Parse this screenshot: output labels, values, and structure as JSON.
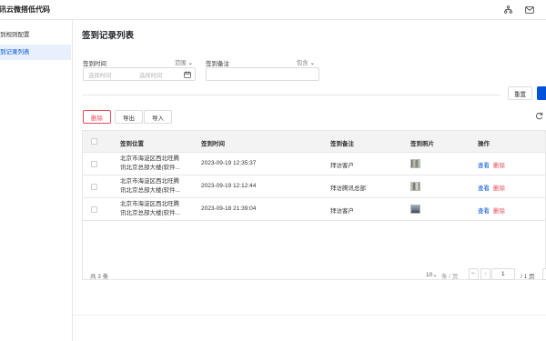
{
  "app": {
    "title": "讯云微搭低代码"
  },
  "header": {
    "icons": [
      "sitemap-icon",
      "mail-icon"
    ]
  },
  "sidebar": {
    "items": [
      {
        "label": "到规则配置",
        "active": false
      },
      {
        "label": "到记录列表",
        "active": true
      }
    ]
  },
  "page": {
    "title": "签到记录列表"
  },
  "filters": {
    "time": {
      "label": "签到时间",
      "mode": "范围",
      "start_placeholder": "选择时间",
      "end_placeholder": "选择时间"
    },
    "note": {
      "label": "签到备注",
      "mode": "包含",
      "value": ""
    }
  },
  "actions": {
    "reset": "重置",
    "delete": "删除",
    "export": "导出",
    "import": "导入"
  },
  "table": {
    "columns": [
      "签到位置",
      "签到时间",
      "签到备注",
      "签到照片",
      "操作"
    ],
    "rows": [
      {
        "location_line1": "北京市海淀区西北旺腾",
        "location_line2": "讯北京总部大楼(软件...",
        "time": "2023-09-19 12:35:37",
        "note": "拜访客户",
        "view": "查看",
        "delete": "删除"
      },
      {
        "location_line1": "北京市海淀区西北旺腾",
        "location_line2": "讯北京总部大楼(软件...",
        "time": "2023-09-19 12:12:44",
        "note": "拜访腾讯总部",
        "view": "查看",
        "delete": "删除"
      },
      {
        "location_line1": "北京市海淀区西北旺腾",
        "location_line2": "讯北京总部大楼(软件...",
        "time": "2023-09-18 21:39:04",
        "note": "拜访客户",
        "view": "查看",
        "delete": "删除"
      }
    ]
  },
  "pagination": {
    "total_text": "共 3 条",
    "page_size": "10",
    "page_size_suffix": "条 / 页",
    "current_page": "1",
    "total_pages_text": "/ 1 页"
  },
  "colors": {
    "primary": "#0052d9",
    "danger": "#e34d59",
    "link": "#0052d9"
  }
}
